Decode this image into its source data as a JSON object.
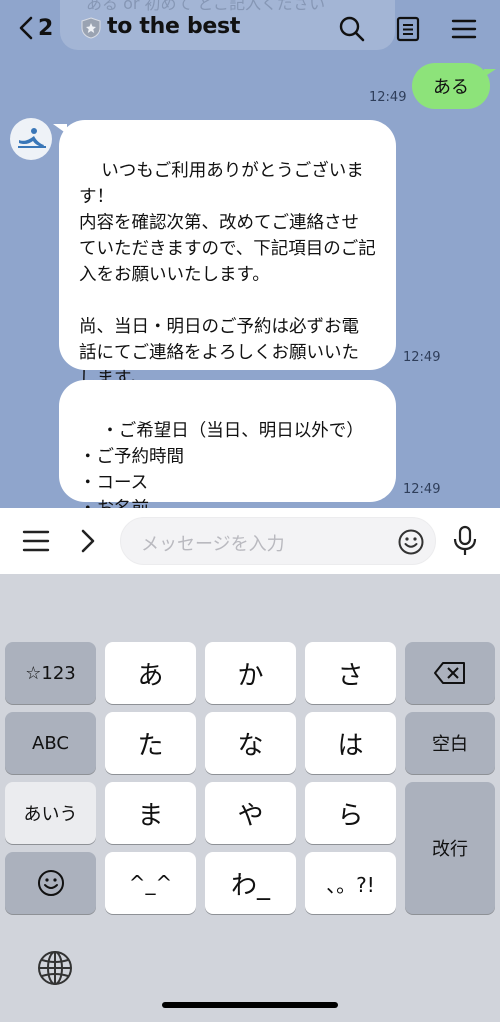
{
  "header": {
    "back_count": "2",
    "title": "to the best"
  },
  "background_ghost_text": "ある or 初めて どご記入ください",
  "messages": [
    {
      "side": "sent",
      "text": "ある",
      "time": "12:49"
    },
    {
      "side": "received",
      "text": "いつもご利用ありがとうございます！\n内容を確認次第、改めてご連絡させていただきますので、下記項目のご記入をお願いいたします。\n\n尚、当日・明日のご予約は必ずお電話にてご連絡をよろしくお願いいたします。",
      "time": "12:49"
    },
    {
      "side": "received",
      "text": "・ご希望日（当日、明日以外で）\n・ご予約時間\n・コース\n・お名前",
      "time": "12:49"
    }
  ],
  "input": {
    "placeholder": "メッセージを入力"
  },
  "keyboard": {
    "row1": [
      "☆123",
      "あ",
      "か",
      "さ"
    ],
    "row2": [
      "ABC",
      "た",
      "な",
      "は",
      "空白"
    ],
    "row3": [
      "あいう",
      "ま",
      "や",
      "ら",
      "改行"
    ],
    "row4": [
      "^_^",
      "わ_",
      "、。?!"
    ]
  },
  "colors": {
    "chat_bg": "#8fa5cc",
    "sent_bubble": "#8de37a",
    "keyboard_bg": "#d1d4db"
  },
  "icons": [
    "chevron-left-icon",
    "shield-icon",
    "search-icon",
    "notes-icon",
    "menu-icon",
    "hamburger-icon",
    "chevron-right-icon",
    "emoji-icon",
    "microphone-icon",
    "backspace-icon",
    "emoji-face-icon",
    "globe-icon"
  ]
}
